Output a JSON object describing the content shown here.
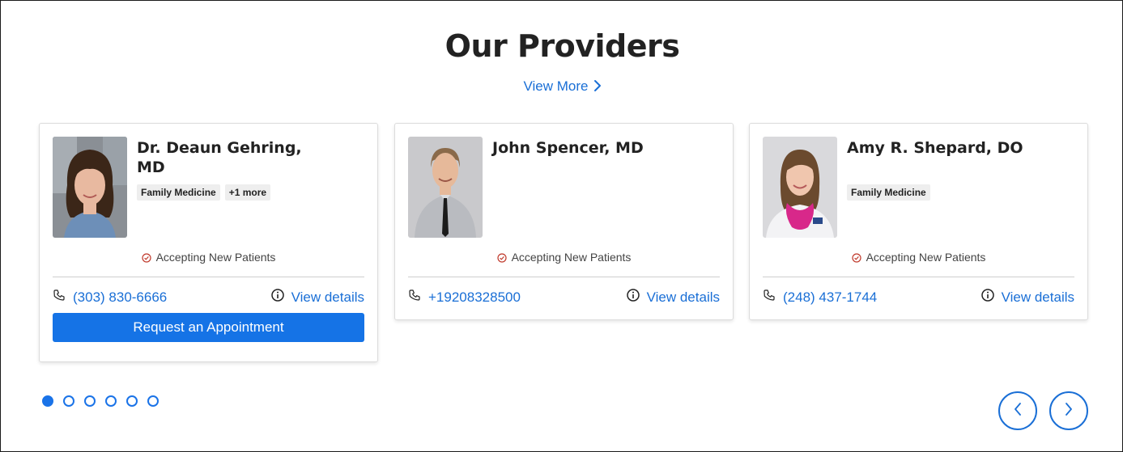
{
  "section": {
    "title": "Our Providers",
    "view_more_label": "View More"
  },
  "providers": [
    {
      "name": "Dr. Deaun Gehring, MD",
      "tags": [
        "Family Medicine",
        "+1 more"
      ],
      "status": "Accepting New Patients",
      "phone": "(303) 830-6666",
      "details_label": "View details",
      "request_label": "Request an Appointment"
    },
    {
      "name": "John Spencer, MD",
      "tags": [],
      "status": "Accepting New Patients",
      "phone": "+19208328500",
      "details_label": "View details"
    },
    {
      "name": "Amy R. Shepard, DO",
      "tags": [
        "Family Medicine"
      ],
      "status": "Accepting New Patients",
      "phone": "(248) 437-1744",
      "details_label": "View details"
    }
  ],
  "pagination": {
    "page_count": 6,
    "active_page": 1
  },
  "icons": {
    "phone": "phone-icon",
    "info": "info-icon",
    "check": "check-circle-icon",
    "prev": "chevron-left-icon",
    "next": "chevron-right-icon"
  },
  "colors": {
    "accent": "#1a6fd6",
    "button": "#1573e6",
    "status_icon": "#c0392b"
  }
}
